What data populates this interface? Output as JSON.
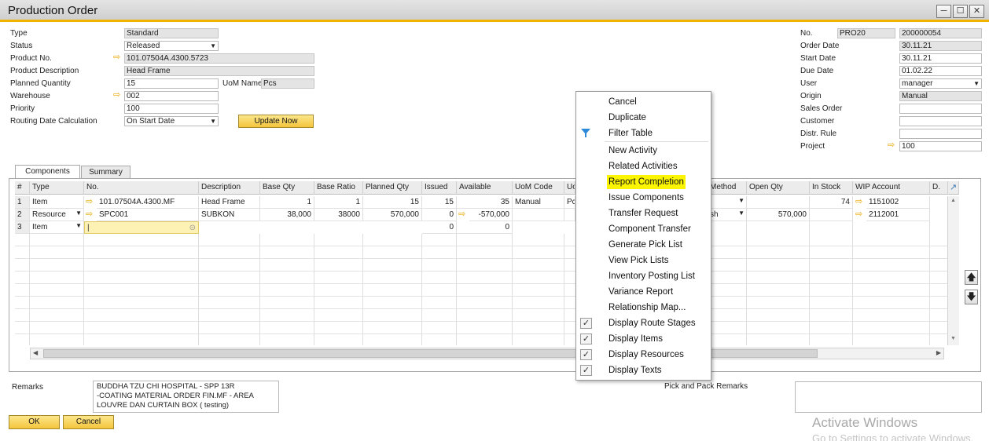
{
  "window": {
    "title": "Production Order",
    "controls": {
      "minimize": "minimize-icon",
      "maximize": "maximize-icon",
      "close": "close-icon"
    }
  },
  "header": {
    "type_label": "Type",
    "type_value": "Standard",
    "status_label": "Status",
    "status_value": "Released",
    "product_no_label": "Product No.",
    "product_no_value": "101.07504A.4300.5723",
    "product_desc_label": "Product Description",
    "product_desc_value": "Head Frame",
    "planned_qty_label": "Planned Quantity",
    "planned_qty_value": "15",
    "uom_name_label": "UoM Name",
    "uom_name_value": "Pcs",
    "warehouse_label": "Warehouse",
    "warehouse_value": "002",
    "priority_label": "Priority",
    "priority_value": "100",
    "routing_label": "Routing Date Calculation",
    "routing_value": "On Start Date",
    "update_button": "Update Now"
  },
  "right_header": {
    "no_label": "No.",
    "series_value": "PRO20",
    "no_value": "200000054",
    "order_date_label": "Order Date",
    "order_date_value": "30.11.21",
    "start_date_label": "Start Date",
    "start_date_value": "30.11.21",
    "due_date_label": "Due Date",
    "due_date_value": "01.02.22",
    "user_label": "User",
    "user_value": "manager",
    "origin_label": "Origin",
    "origin_value": "Manual",
    "sales_order_label": "Sales Order",
    "sales_order_value": "",
    "customer_label": "Customer",
    "customer_value": "",
    "distr_rule_label": "Distr. Rule",
    "distr_rule_value": "",
    "project_label": "Project",
    "project_value": "100"
  },
  "tabs": {
    "components": "Components",
    "summary": "Summary"
  },
  "grid": {
    "headers": {
      "row": "#",
      "type": "Type",
      "no": "No.",
      "description": "Description",
      "base_qty": "Base Qty",
      "base_ratio": "Base Ratio",
      "planned_qty": "Planned Qty",
      "issued": "Issued",
      "available": "Available",
      "uom_code": "UoM Code",
      "uo": "Uo",
      "method": "Method",
      "open_qty": "Open Qty",
      "in_stock": "In Stock",
      "wip_account": "WIP Account",
      "d": "D."
    },
    "rows": [
      {
        "num": "1",
        "type": "Item",
        "no": "101.07504A.4300.MF",
        "description": "Head Frame",
        "base_qty": "1",
        "base_ratio": "1",
        "planned_qty": "15",
        "issued": "15",
        "available": "35",
        "uom_code": "Manual",
        "uo": "Pc",
        "method": "",
        "open_qty": "",
        "in_stock": "74",
        "wip_account": "1151002"
      },
      {
        "num": "2",
        "type": "Resource",
        "no": "SPC001",
        "description": "SUBKON",
        "base_qty": "38,000",
        "base_ratio": "38000",
        "planned_qty": "570,000",
        "issued": "0",
        "available": "-570,000",
        "uom_code": "",
        "uo": "",
        "method": "sh",
        "open_qty": "570,000",
        "in_stock": "",
        "wip_account": "2112001"
      },
      {
        "num": "3",
        "type": "Item",
        "no": "",
        "description": "",
        "base_qty": "",
        "base_ratio": "",
        "planned_qty": "",
        "issued": "0",
        "available": "0",
        "uom_code": "",
        "uo": "",
        "method": "",
        "open_qty": "",
        "in_stock": "",
        "wip_account": ""
      }
    ]
  },
  "context_menu": {
    "items": [
      {
        "label": "Cancel"
      },
      {
        "label": "Duplicate"
      },
      {
        "label": "Filter Table",
        "icon": "filter-icon"
      },
      {
        "label": "New Activity"
      },
      {
        "label": "Related Activities"
      },
      {
        "label": "Report Completion",
        "highlighted": true
      },
      {
        "label": "Issue Components"
      },
      {
        "label": "Transfer Request"
      },
      {
        "label": "Component Transfer"
      },
      {
        "label": "Generate Pick List"
      },
      {
        "label": "View Pick Lists"
      },
      {
        "label": "Inventory Posting List"
      },
      {
        "label": "Variance Report"
      },
      {
        "label": "Relationship Map..."
      },
      {
        "label": "Display Route Stages",
        "checked": true
      },
      {
        "label": "Display Items",
        "checked": true
      },
      {
        "label": "Display Resources",
        "checked": true
      },
      {
        "label": "Display Texts",
        "checked": true
      }
    ],
    "highlight_color": "#fbf600"
  },
  "footer": {
    "remarks_label": "Remarks",
    "remarks_lines": [
      "BUDDHA TZU CHI HOSPITAL - SPP 13R",
      "-COATING MATERIAL ORDER FIN.MF - AREA",
      "LOUVRE DAN CURTAIN  BOX ( testing)"
    ],
    "pick_pack_label": "Pick and Pack Remarks",
    "ok_button": "OK",
    "cancel_button": "Cancel"
  },
  "watermark": {
    "line1": "Activate Windows",
    "line2": "Go to Settings to activate Windows."
  },
  "colors": {
    "accent": "#f0b400",
    "link_arrow": "#e8a800",
    "button": "#f3c53c"
  }
}
